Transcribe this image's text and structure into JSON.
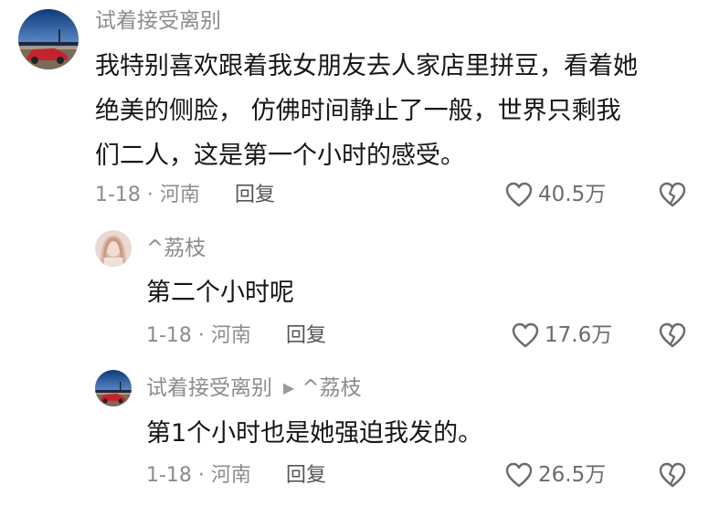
{
  "comments": [
    {
      "username": "试着接受离别",
      "text": "我特别喜欢跟着我女朋友去人家店里拼豆，看着她\n绝美的侧脸， 仿佛时间静止了一般，世界只剩我\n们二人，这是第一个小时的感受。",
      "date_location": "1-18 · 河南",
      "reply_label": "回复",
      "likes": "40.5万"
    }
  ],
  "replies": [
    {
      "username": "^荔枝",
      "reply_to": "",
      "text": "第二个小时呢",
      "date_location": "1-18 · 河南",
      "reply_label": "回复",
      "likes": "17.6万"
    },
    {
      "username": "试着接受离别",
      "reply_to": "^荔枝",
      "text": "第1个小时也是她强迫我发的。",
      "date_location": "1-18 · 河南",
      "reply_label": "回复",
      "likes": "26.5万"
    }
  ],
  "colors": {
    "text": "#161616",
    "muted": "#8c8c8c",
    "icon": "#6b6b6b",
    "background": "#ffffff"
  },
  "icons": [
    "like-heart-icon",
    "dislike-broken-heart-icon",
    "reply-arrow-icon"
  ]
}
